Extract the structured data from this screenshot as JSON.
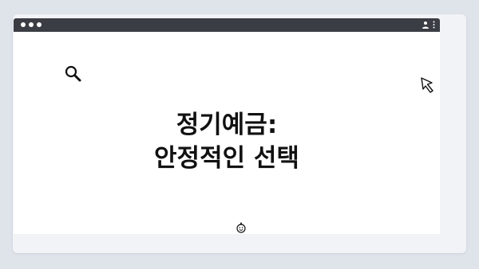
{
  "page": {
    "heading_line1": "정기예금:",
    "heading_line2": "안정적인 선택"
  },
  "icons": {
    "top_bar": "pagination-dots-icon",
    "window_controls": "window-controls-icon",
    "profile": "user-icon",
    "menu": "more-vertical-icon",
    "search": "search-icon",
    "cursor": "cursor-icon",
    "bottom": "smile-icon"
  },
  "colors": {
    "background": "#dfe3ea",
    "titlebar": "#3a3d43",
    "content": "#ffffff",
    "text": "#111111"
  }
}
